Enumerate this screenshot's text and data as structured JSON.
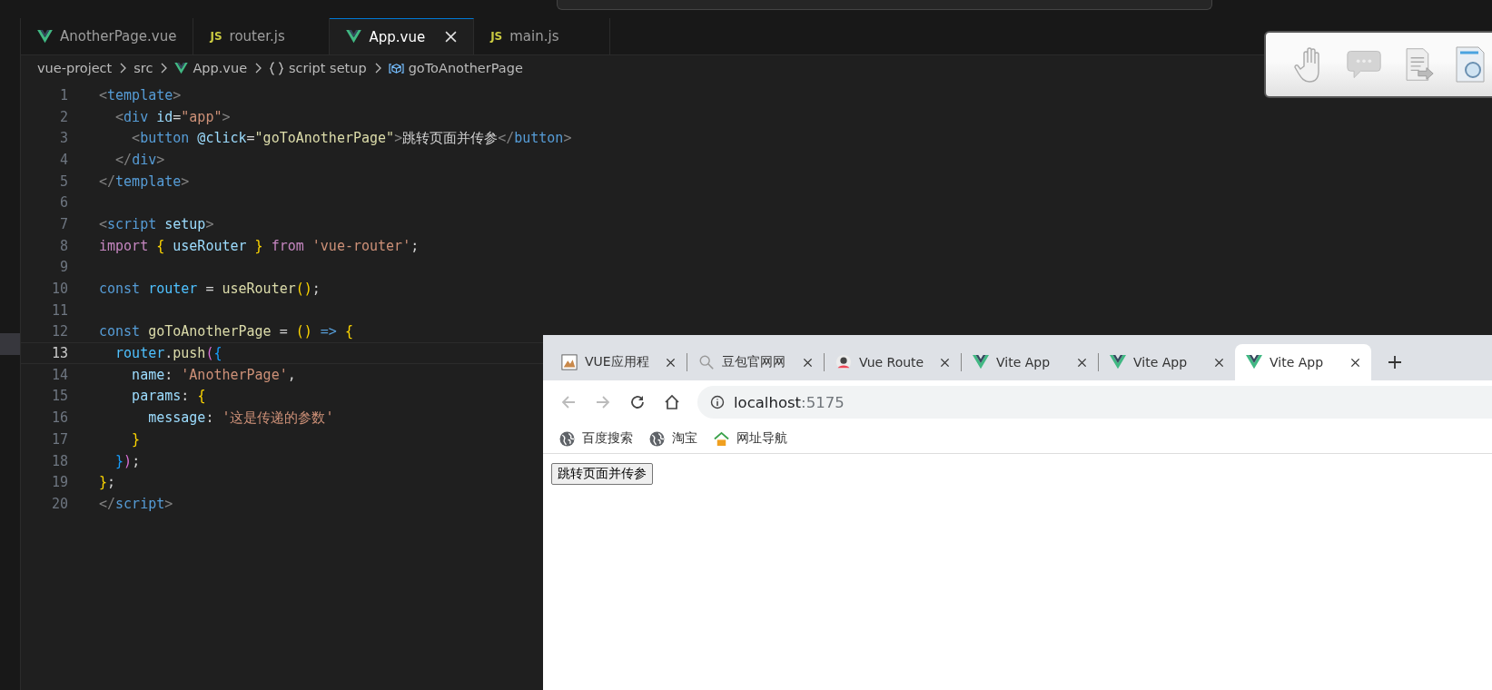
{
  "editor": {
    "tabs": [
      {
        "label": "AnotherPage.vue",
        "kind": "vue",
        "selected": false
      },
      {
        "label": "router.js",
        "kind": "js",
        "icon_label": "JS",
        "selected": false
      },
      {
        "label": "App.vue",
        "kind": "vue",
        "selected": true
      },
      {
        "label": "main.js",
        "kind": "js",
        "icon_label": "JS",
        "selected": false
      }
    ],
    "breadcrumbs": [
      {
        "label": "vue-project",
        "kind": "folder"
      },
      {
        "label": "src",
        "kind": "folder"
      },
      {
        "label": "App.vue",
        "kind": "vue"
      },
      {
        "label": "script setup",
        "kind": "braces"
      },
      {
        "label": "goToAnotherPage",
        "kind": "method"
      }
    ],
    "lines": [
      {
        "number": "1",
        "current": false,
        "tokens": [
          {
            "text": "<",
            "kind": "punct-tag"
          },
          {
            "text": "template",
            "kind": "tag"
          },
          {
            "text": ">",
            "kind": "punct-tag"
          }
        ]
      },
      {
        "number": "2",
        "current": false,
        "tokens": [
          {
            "text": "  <",
            "kind": "punct-tag"
          },
          {
            "text": "div",
            "kind": "tag"
          },
          {
            "text": " id",
            "kind": "attr"
          },
          {
            "text": "=",
            "kind": "plain"
          },
          {
            "text": "\"app\"",
            "kind": "string"
          },
          {
            "text": ">",
            "kind": "punct-tag"
          }
        ]
      },
      {
        "number": "3",
        "current": false,
        "tokens": [
          {
            "text": "    <",
            "kind": "punct-tag"
          },
          {
            "text": "button",
            "kind": "tag"
          },
          {
            "text": " @click",
            "kind": "attr"
          },
          {
            "text": "=",
            "kind": "plain"
          },
          {
            "text": "\"goToAnotherPage\"",
            "kind": "func"
          },
          {
            "text": ">",
            "kind": "punct-tag"
          },
          {
            "text": "跳转页面并传参",
            "kind": "plain"
          },
          {
            "text": "</",
            "kind": "punct-tag"
          },
          {
            "text": "button",
            "kind": "tag"
          },
          {
            "text": ">",
            "kind": "punct-tag"
          }
        ]
      },
      {
        "number": "4",
        "current": false,
        "tokens": [
          {
            "text": "  </",
            "kind": "punct-tag"
          },
          {
            "text": "div",
            "kind": "tag"
          },
          {
            "text": ">",
            "kind": "punct-tag"
          }
        ]
      },
      {
        "number": "5",
        "current": false,
        "tokens": [
          {
            "text": "</",
            "kind": "punct-tag"
          },
          {
            "text": "template",
            "kind": "tag"
          },
          {
            "text": ">",
            "kind": "punct-tag"
          }
        ]
      },
      {
        "number": "6",
        "current": false
      },
      {
        "number": "7",
        "current": false,
        "tokens": [
          {
            "text": "<",
            "kind": "punct-tag"
          },
          {
            "text": "script",
            "kind": "tag"
          },
          {
            "text": " setup",
            "kind": "attr"
          },
          {
            "text": ">",
            "kind": "punct-tag"
          }
        ]
      },
      {
        "number": "8",
        "current": false,
        "tokens": [
          {
            "text": "import ",
            "kind": "control"
          },
          {
            "text": "{",
            "kind": "brace"
          },
          {
            "text": " useRouter ",
            "kind": "attr"
          },
          {
            "text": "}",
            "kind": "brace"
          },
          {
            "text": " from ",
            "kind": "control"
          },
          {
            "text": "'vue-router'",
            "kind": "string"
          },
          {
            "text": ";",
            "kind": "plain"
          }
        ]
      },
      {
        "number": "9",
        "current": false
      },
      {
        "number": "10",
        "current": false,
        "tokens": [
          {
            "text": "const ",
            "kind": "keyword"
          },
          {
            "text": "router",
            "kind": "const"
          },
          {
            "text": " = ",
            "kind": "plain"
          },
          {
            "text": "useRouter",
            "kind": "func"
          },
          {
            "text": "()",
            "kind": "brace"
          },
          {
            "text": ";",
            "kind": "plain"
          }
        ]
      },
      {
        "number": "11",
        "current": false
      },
      {
        "number": "12",
        "current": false,
        "tokens": [
          {
            "text": "const ",
            "kind": "keyword"
          },
          {
            "text": "goToAnotherPage",
            "kind": "func"
          },
          {
            "text": " = ",
            "kind": "plain"
          },
          {
            "text": "()",
            "kind": "brace"
          },
          {
            "text": " =>",
            "kind": "keyword"
          },
          {
            "text": " {",
            "kind": "brace"
          }
        ]
      },
      {
        "number": "13",
        "current": true,
        "tokens": [
          {
            "text": "  router",
            "kind": "const"
          },
          {
            "text": ".",
            "kind": "plain"
          },
          {
            "text": "push",
            "kind": "func"
          },
          {
            "text": "(",
            "kind": "brace2"
          },
          {
            "text": "{",
            "kind": "brace3"
          }
        ]
      },
      {
        "number": "14",
        "current": false,
        "tokens": [
          {
            "text": "    name",
            "kind": "attr"
          },
          {
            "text": ": ",
            "kind": "plain"
          },
          {
            "text": "'AnotherPage'",
            "kind": "string"
          },
          {
            "text": ",",
            "kind": "plain"
          }
        ]
      },
      {
        "number": "15",
        "current": false,
        "tokens": [
          {
            "text": "    params",
            "kind": "attr"
          },
          {
            "text": ": ",
            "kind": "plain"
          },
          {
            "text": "{",
            "kind": "brace"
          }
        ]
      },
      {
        "number": "16",
        "current": false,
        "tokens": [
          {
            "text": "      message",
            "kind": "attr"
          },
          {
            "text": ": ",
            "kind": "plain"
          },
          {
            "text": "'这是传递的参数'",
            "kind": "string"
          }
        ]
      },
      {
        "number": "17",
        "current": false,
        "tokens": [
          {
            "text": "    }",
            "kind": "brace"
          }
        ]
      },
      {
        "number": "18",
        "current": false,
        "tokens": [
          {
            "text": "  }",
            "kind": "brace3"
          },
          {
            "text": ")",
            "kind": "brace2"
          },
          {
            "text": ";",
            "kind": "plain"
          }
        ]
      },
      {
        "number": "19",
        "current": false,
        "tokens": [
          {
            "text": "}",
            "kind": "brace"
          },
          {
            "text": ";",
            "kind": "plain"
          }
        ]
      },
      {
        "number": "20",
        "current": false,
        "tokens": [
          {
            "text": "</",
            "kind": "punct-tag"
          },
          {
            "text": "script",
            "kind": "tag"
          },
          {
            "text": ">",
            "kind": "punct-tag"
          }
        ]
      }
    ]
  },
  "browser": {
    "tabs": [
      {
        "title": "VUE应用程",
        "kind": "picture",
        "selected": false
      },
      {
        "title": "豆包官网网",
        "kind": "search",
        "selected": false
      },
      {
        "title": "Vue Route",
        "kind": "avatar",
        "selected": false
      },
      {
        "title": "Vite App",
        "kind": "vue",
        "selected": false
      },
      {
        "title": "Vite App",
        "kind": "vue",
        "selected": false
      },
      {
        "title": "Vite App",
        "kind": "vue",
        "selected": true
      }
    ],
    "address": {
      "host": "localhost",
      "port": ":5175"
    },
    "bookmarks": [
      {
        "label": "百度搜索",
        "kind": "globe"
      },
      {
        "label": "淘宝",
        "kind": "globe"
      },
      {
        "label": "网址导航",
        "kind": "house"
      }
    ],
    "page": {
      "button": "跳转页面并传参"
    }
  }
}
